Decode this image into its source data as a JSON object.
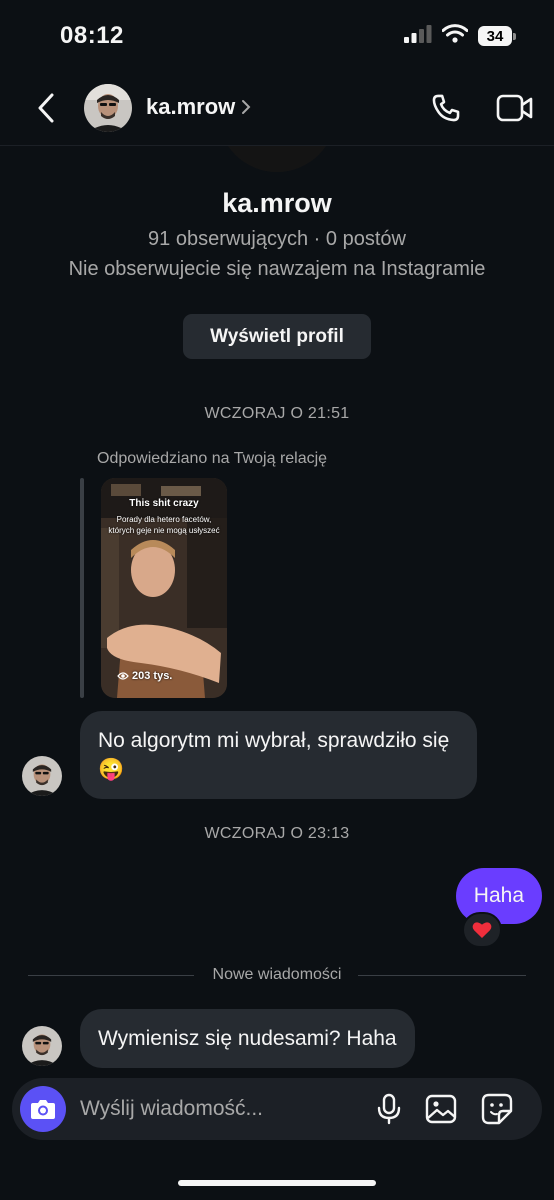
{
  "status_bar": {
    "time": "08:12",
    "battery": "34"
  },
  "header": {
    "username": "ka.mrow"
  },
  "profile": {
    "username": "ka.mrow",
    "stats": "91 obserwujących · 0 postów",
    "follow_status": "Nie obserwujecie się nawzajem na Instagramie",
    "view_profile_label": "Wyświetl profil"
  },
  "thread": {
    "timestamp_1": "WCZORAJ O 21:51",
    "reply_note": "Odpowiedziano na Twoją relację",
    "story": {
      "caption": "This shit crazy",
      "subcaption": "Porady dla hetero facetów, których geje nie mogą usłyszeć",
      "views": "203 tys."
    },
    "message_1": "No algorytm mi wybrał, sprawdziło się 😜",
    "timestamp_2": "WCZORAJ O 23:13",
    "message_2": "Haha",
    "reaction": "❤️",
    "new_messages_label": "Nowe wiadomości",
    "message_3": "Wymienisz się nudesami? Haha"
  },
  "composer": {
    "placeholder": "Wyślij wiadomość..."
  },
  "colors": {
    "background": "#0c1014",
    "incoming_bubble": "#262b31",
    "outgoing_bubble": "#6a3dff",
    "camera_button": "#5b51f5"
  }
}
